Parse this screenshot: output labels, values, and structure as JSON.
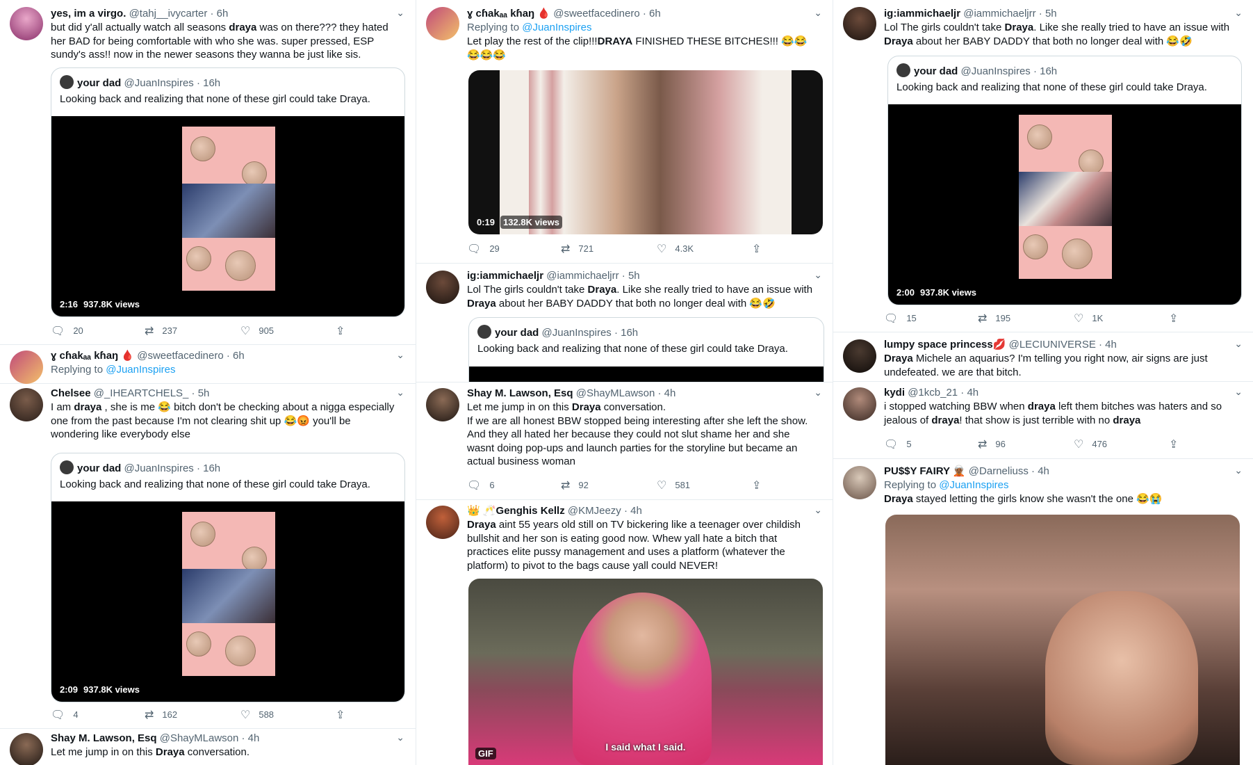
{
  "col1": {
    "t1": {
      "name": "yes, im a virgo.",
      "handle": "@tahj__ivycarter · 6h",
      "text_a": "but did y'all actually watch all seasons ",
      "text_b": "draya",
      "text_c": " was on there??? they hated her BAD for being comfortable with who she was. super pressed, ESP sundy's ass!! now in the newer seasons they wanna be just like sis.",
      "quote_name": "your dad",
      "quote_handle": "@JuanInspires · 16h",
      "quote_text": "Looking back and realizing that none of these girl could take Draya.",
      "duration": "2:16",
      "views": "937.8K views",
      "replies": "20",
      "retweets": "237",
      "likes": "905"
    },
    "t2": {
      "name": "ɣ cɦakₐₐ kɦaŋ 🩸",
      "handle": "@sweetfacedinero · 6h",
      "replying": "Replying to ",
      "mention": "@JuanInspires"
    },
    "t3": {
      "name": "Chelsee",
      "handle": "@_IHEARTCHELS_ · 5h",
      "text_a": "I am ",
      "text_b": "draya",
      "text_c": " , she is me 😂 bitch don't be checking about a nigga especially one from the past because I'm not clearing shit up 😂😡 you'll be wondering like everybody else",
      "quote_name": "your dad",
      "quote_handle": "@JuanInspires · 16h",
      "quote_text": "Looking back and realizing that none of these girl could take Draya.",
      "duration": "2:09",
      "views": "937.8K views",
      "replies": "4",
      "retweets": "162",
      "likes": "588"
    },
    "t4": {
      "name": "Shay M. Lawson, Esq",
      "handle": "@ShayMLawson · 4h",
      "text_a": "Let me jump in on this ",
      "text_b": "Draya",
      "text_c": " conversation."
    }
  },
  "col2": {
    "t1": {
      "name": "ɣ cɦakₐₐ kɦaŋ 🩸",
      "handle": "@sweetfacedinero · 6h",
      "replying": "Replying to ",
      "mention": "@JuanInspires",
      "text_a": "Let play the rest of the clip!!!",
      "text_b": "DRAYA",
      "text_c": " FINISHED THESE BITCHES!!! 😂😂😂😂😂",
      "duration": "0:19",
      "views": "132.8K views",
      "replies": "29",
      "retweets": "721",
      "likes": "4.3K"
    },
    "t2": {
      "name": "ig:iammichaeljr",
      "handle": "@iammichaeljrr · 5h",
      "text_a": "Lol The girls couldn't take ",
      "text_b": "Draya",
      "text_c": ". Like she really tried to have an issue with ",
      "text_d": "Draya",
      "text_e": " about her BABY DADDY that both no longer deal with 😂🤣",
      "quote_name": "your dad",
      "quote_handle": "@JuanInspires · 16h",
      "quote_text": "Looking back and realizing that none of these girl could take Draya."
    },
    "t3": {
      "name": "Shay M. Lawson, Esq",
      "handle": "@ShayMLawson · 4h",
      "text_a": "Let me jump in on this ",
      "text_b": "Draya",
      "text_c": " conversation.",
      "text_d": "If we are all honest BBW stopped being interesting after she left the show. And they all hated her because they could not slut shame her and she wasnt doing pop-ups and launch parties for the storyline but became an actual business woman",
      "replies": "6",
      "retweets": "92",
      "likes": "581"
    },
    "t4": {
      "name": "👑 🥂Genghis Kellz",
      "handle": "@KMJeezy · 4h",
      "text_a": "Draya",
      "text_b": " aint 55 years old still on TV bickering like a teenager over childish bullshit and her son is eating good now. Whew yall hate a bitch that practices elite pussy management and uses a platform (whatever the platform) to pivot to the bags cause yall could NEVER!",
      "caption": "I said what I said.",
      "gif": "GIF"
    }
  },
  "col3": {
    "t1": {
      "name": "ig:iammichaeljr",
      "handle": "@iammichaeljrr · 5h",
      "text_a": "Lol The girls couldn't take ",
      "text_b": "Draya",
      "text_c": ". Like she really tried to have an issue with ",
      "text_d": "Draya",
      "text_e": " about her BABY DADDY that both no longer deal with 😂🤣",
      "quote_name": "your dad",
      "quote_handle": "@JuanInspires · 16h",
      "quote_text": "Looking back and realizing that none of these girl could take Draya.",
      "duration": "2:00",
      "views": "937.8K views",
      "replies": "15",
      "retweets": "195",
      "likes": "1K"
    },
    "t2": {
      "name": "lumpy space princess💋",
      "handle": "@LECIUNIVERSE · 4h",
      "text_a": "Draya",
      "text_b": " Michele an aquarius? I'm telling you right now, air signs are just undefeated. we are that bitch."
    },
    "t3": {
      "name": "kydi",
      "handle": "@1kcb_21 · 4h",
      "text_a": "i stopped watching BBW when ",
      "text_b": "draya",
      "text_c": " left them bitches was haters and so jealous of ",
      "text_d": "draya",
      "text_e": "! that show is just terrible with no ",
      "text_f": "draya",
      "replies": "5",
      "retweets": "96",
      "likes": "476"
    },
    "t4": {
      "name": "PU$$Y FAIRY 🧝🏾",
      "handle": "@Darneliuss · 4h",
      "replying": "Replying to ",
      "mention": "@JuanInspires",
      "text_a": "Draya",
      "text_b": " stayed letting the girls know she wasn't the one 😂😭"
    }
  },
  "icons": {
    "reply": "reply-icon",
    "retweet": "retweet-icon",
    "like": "heart-icon",
    "share": "share-icon",
    "more": "chevron-down-icon"
  },
  "colors": {
    "accent": "#1da1f2",
    "secondary": "#536471",
    "border": "#e6ecf0"
  }
}
